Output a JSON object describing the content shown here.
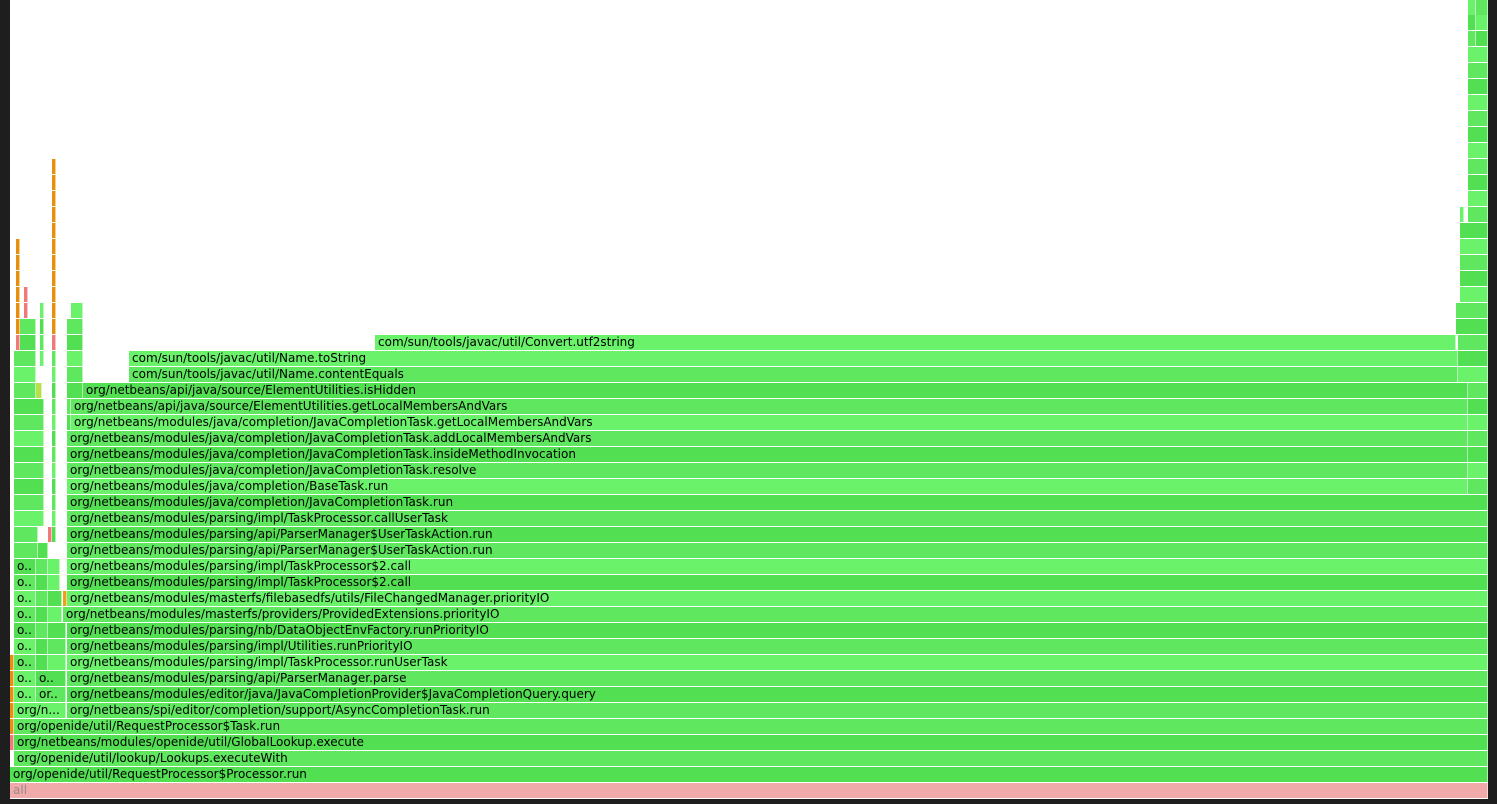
{
  "flamegraph": {
    "root_label": "all",
    "colors": {
      "background": "#1e1e1e",
      "canvas": "#ffffff",
      "root": "#f0aaaa",
      "frame_green": "#5fe85f",
      "frame_orange": "#e5900f",
      "frame_red": "#ef7a7a"
    },
    "frames": {
      "main": [
        "com/sun/tools/javac/util/Convert.utf2string",
        "com/sun/tools/javac/util/Name.toString",
        "com/sun/tools/javac/util/Name.contentEquals",
        "org/netbeans/api/java/source/ElementUtilities.isHidden",
        "org/netbeans/api/java/source/ElementUtilities.getLocalMembersAndVars",
        "org/netbeans/modules/java/completion/JavaCompletionTask.getLocalMembersAndVars",
        "org/netbeans/modules/java/completion/JavaCompletionTask.addLocalMembersAndVars",
        "org/netbeans/modules/java/completion/JavaCompletionTask.insideMethodInvocation",
        "org/netbeans/modules/java/completion/JavaCompletionTask.resolve",
        "org/netbeans/modules/java/completion/BaseTask.run",
        "org/netbeans/modules/java/completion/JavaCompletionTask.run",
        "org/netbeans/modules/parsing/impl/TaskProcessor.callUserTask",
        "org/netbeans/modules/parsing/api/ParserManager$UserTaskAction.run",
        "org/netbeans/modules/parsing/api/ParserManager$UserTaskAction.run",
        "org/netbeans/modules/parsing/impl/TaskProcessor$2.call",
        "org/netbeans/modules/parsing/impl/TaskProcessor$2.call",
        "org/netbeans/modules/masterfs/filebasedfs/utils/FileChangedManager.priorityIO",
        "org/netbeans/modules/masterfs/providers/ProvidedExtensions.priorityIO",
        "org/netbeans/modules/parsing/nb/DataObjectEnvFactory.runPriorityIO",
        "org/netbeans/modules/parsing/impl/Utilities.runPriorityIO",
        "org/netbeans/modules/parsing/impl/TaskProcessor.runUserTask",
        "org/netbeans/modules/parsing/api/ParserManager.parse",
        "org/netbeans/modules/editor/java/JavaCompletionProvider$JavaCompletionQuery.query",
        "org/netbeans/spi/editor/completion/support/AsyncCompletionTask.run",
        "org/openide/util/RequestProcessor$Task.run",
        "org/netbeans/modules/openide/util/GlobalLookup.execute",
        "org/openide/util/lookup/Lookups.executeWith",
        "org/openide/util/RequestProcessor$Processor.run"
      ],
      "truncated": [
        "o..",
        "o..",
        "o..",
        "o..",
        "o..",
        "o..",
        "o..",
        "o..",
        "o..",
        "o..",
        "or..",
        "org/n..."
      ]
    }
  }
}
